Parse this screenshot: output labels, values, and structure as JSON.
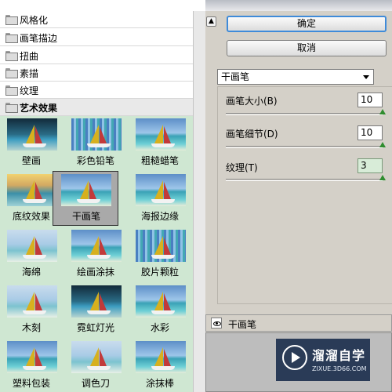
{
  "categories": [
    {
      "label": "风格化",
      "open": false
    },
    {
      "label": "画笔描边",
      "open": false
    },
    {
      "label": "扭曲",
      "open": false
    },
    {
      "label": "素描",
      "open": false
    },
    {
      "label": "纹理",
      "open": false
    },
    {
      "label": "艺术效果",
      "open": true
    }
  ],
  "filters": [
    {
      "label": "壁画",
      "selected": false
    },
    {
      "label": "彩色铅笔",
      "selected": false
    },
    {
      "label": "粗糙蜡笔",
      "selected": false
    },
    {
      "label": "底纹效果",
      "selected": false
    },
    {
      "label": "干画笔",
      "selected": true
    },
    {
      "label": "海报边缘",
      "selected": false
    },
    {
      "label": "海绵",
      "selected": false
    },
    {
      "label": "绘画涂抹",
      "selected": false
    },
    {
      "label": "胶片颗粒",
      "selected": false
    },
    {
      "label": "木刻",
      "selected": false
    },
    {
      "label": "霓虹灯光",
      "selected": false
    },
    {
      "label": "水彩",
      "selected": false
    },
    {
      "label": "塑料包装",
      "selected": false
    },
    {
      "label": "调色刀",
      "selected": false
    },
    {
      "label": "涂抹棒",
      "selected": false
    }
  ],
  "buttons": {
    "ok": "确定",
    "cancel": "取消"
  },
  "filter_select": {
    "value": "干画笔"
  },
  "params": [
    {
      "label": "画笔大小(B)",
      "value": "10",
      "level": 1.0
    },
    {
      "label": "画笔细节(D)",
      "value": "10",
      "level": 1.0
    },
    {
      "label": "纹理(T)",
      "value": "3",
      "level": 1.0
    }
  ],
  "preview": {
    "title": "干画笔"
  },
  "watermark": {
    "title": "溜溜自学",
    "subtitle": "ZIXUE.3D66.COM"
  },
  "colors": {
    "thumb_bg": "#cfe7d2",
    "accent_blue": "#3f8bd9",
    "slider_green": "#2f8d2f"
  }
}
